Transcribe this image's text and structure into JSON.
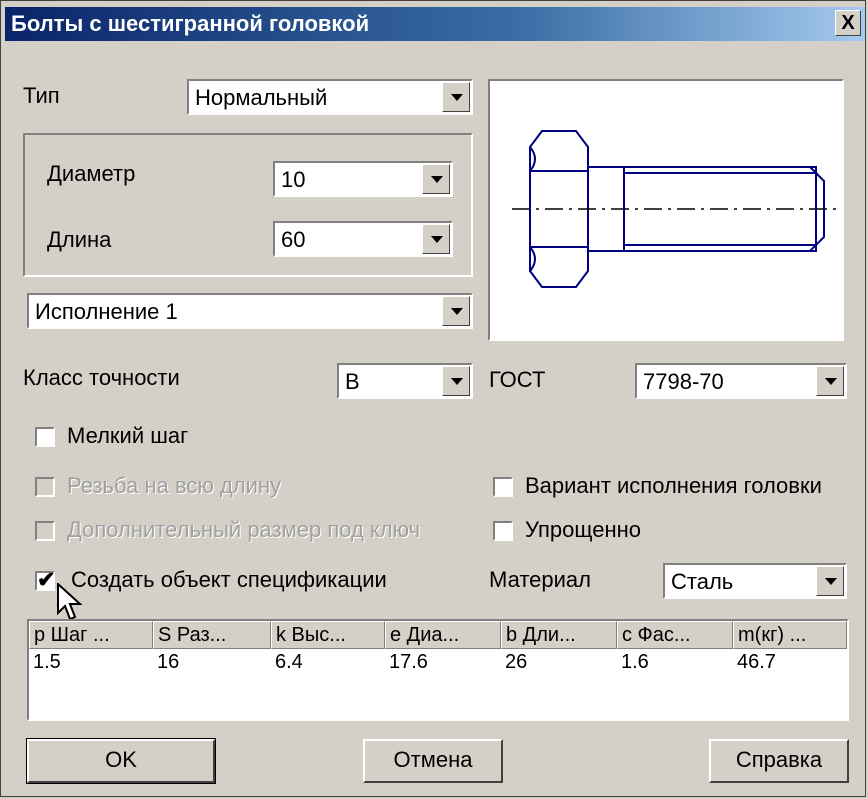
{
  "window": {
    "title": "Болты с шестигранной головкой",
    "close_label": "X"
  },
  "type": {
    "label": "Тип",
    "value": "Нормальный"
  },
  "diameter": {
    "label": "Диаметр",
    "value": "10"
  },
  "length": {
    "label": "Длина",
    "value": "60"
  },
  "execution": {
    "value": "Исполнение 1"
  },
  "accuracy": {
    "label": "Класс точности",
    "value": "B"
  },
  "gost": {
    "label": "ГОСТ",
    "value": "7798-70"
  },
  "checkboxes": {
    "fine_pitch": {
      "label": "Мелкий шаг",
      "checked": false,
      "enabled": true
    },
    "full_thread": {
      "label": "Резьба на всю длину",
      "checked": false,
      "enabled": false
    },
    "extra_key_size": {
      "label": "Дополнительный размер под ключ",
      "checked": false,
      "enabled": false
    },
    "create_spec": {
      "label": "Создать объект спецификации",
      "checked": true,
      "enabled": true
    },
    "head_variant": {
      "label": "Вариант исполнения головки",
      "checked": false,
      "enabled": true
    },
    "simplified": {
      "label": "Упрощенно",
      "checked": false,
      "enabled": true
    }
  },
  "material": {
    "label": "Материал",
    "value": "Сталь"
  },
  "table": {
    "headers": [
      "p Шаг ...",
      "S Раз...",
      "k Выс...",
      "e Диа...",
      "b Дли...",
      "c Фас...",
      "m(кг) ..."
    ],
    "row": [
      "1.5",
      "16",
      "6.4",
      "17.6",
      "26",
      "1.6",
      "46.7"
    ]
  },
  "buttons": {
    "ok": "OK",
    "cancel": "Отмена",
    "help": "Справка"
  },
  "colors": {
    "title_bar": "#0a246a",
    "face": "#d4d0c8",
    "drawing": "#000080"
  },
  "icons": {
    "check": "✔",
    "cursor": "arrow-cursor"
  }
}
